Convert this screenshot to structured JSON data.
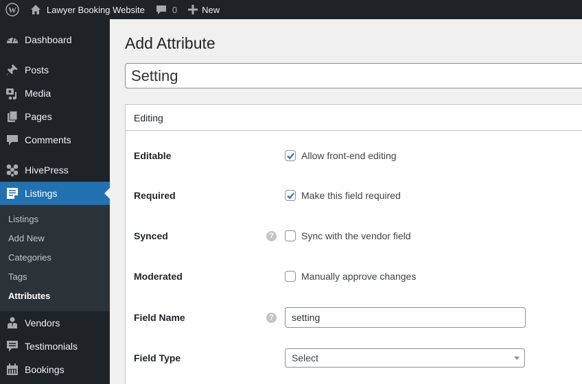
{
  "adminbar": {
    "site_name": "Lawyer Booking Website",
    "comments_count": "0",
    "new_label": "New"
  },
  "sidebar": {
    "items": [
      {
        "label": "Dashboard",
        "icon": "dashboard-icon"
      },
      {
        "label": "Posts",
        "icon": "pin-icon"
      },
      {
        "label": "Media",
        "icon": "media-icon"
      },
      {
        "label": "Pages",
        "icon": "pages-icon"
      },
      {
        "label": "Comments",
        "icon": "comment-icon"
      },
      {
        "label": "HivePress",
        "icon": "hivepress-icon"
      },
      {
        "label": "Listings",
        "icon": "listings-icon"
      },
      {
        "label": "Vendors",
        "icon": "vendor-icon"
      },
      {
        "label": "Testimonials",
        "icon": "testimonial-icon"
      },
      {
        "label": "Bookings",
        "icon": "calendar-icon"
      }
    ],
    "submenu": [
      "Listings",
      "Add New",
      "Categories",
      "Tags",
      "Attributes"
    ],
    "current_submenu": "Attributes",
    "accent_color": "#2271b1"
  },
  "main": {
    "page_title": "Add Attribute",
    "title_value": "Setting",
    "section_title": "Editing",
    "fields": {
      "editable": {
        "label": "Editable",
        "checkbox_label": "Allow front-end editing",
        "checked": true
      },
      "required": {
        "label": "Required",
        "checkbox_label": "Make this field required",
        "checked": true
      },
      "synced": {
        "label": "Synced",
        "checkbox_label": "Sync with the vendor field",
        "checked": false,
        "help": "?"
      },
      "moderated": {
        "label": "Moderated",
        "checkbox_label": "Manually approve changes",
        "checked": false
      },
      "field_name": {
        "label": "Field Name",
        "value": "setting",
        "help": "?"
      },
      "field_type": {
        "label": "Field Type",
        "value": "Select"
      }
    }
  }
}
